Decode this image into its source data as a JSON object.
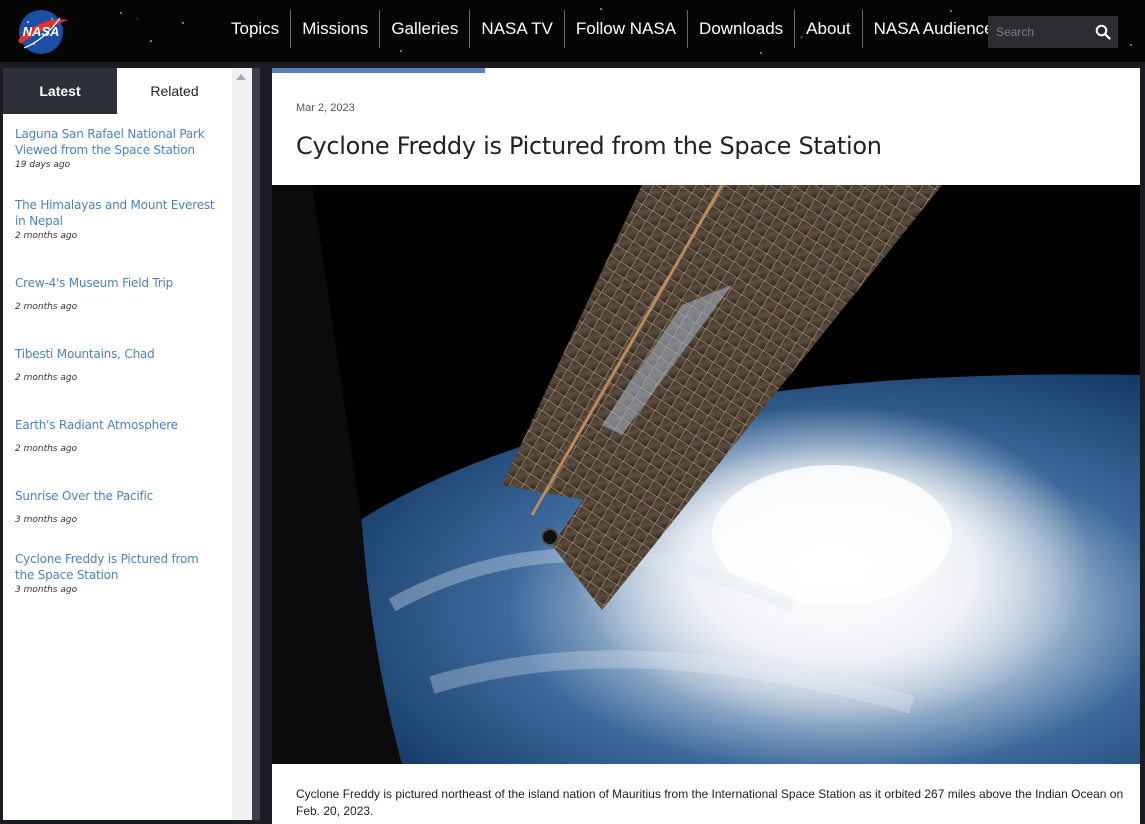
{
  "brand": {
    "logo_text": "NASA"
  },
  "nav": {
    "items": [
      "Topics",
      "Missions",
      "Galleries",
      "NASA TV",
      "Follow NASA",
      "Downloads",
      "About",
      "NASA Audiences"
    ]
  },
  "search": {
    "placeholder": "Search"
  },
  "sidebar": {
    "tabs": {
      "latest": "Latest",
      "related": "Related"
    },
    "items": [
      {
        "title": "Laguna San Rafael National Park Viewed from the Space Station",
        "age": "19 days ago"
      },
      {
        "title": "The Himalayas and Mount Everest in Nepal",
        "age": "2 months ago"
      },
      {
        "title": "Crew-4's Museum Field Trip",
        "age": "2 months ago"
      },
      {
        "title": "Tibesti Mountains, Chad",
        "age": "2 months ago"
      },
      {
        "title": "Earth's Radiant Atmosphere",
        "age": "2 months ago"
      },
      {
        "title": "Sunrise Over the Pacific",
        "age": "3 months ago"
      },
      {
        "title": "Cyclone Freddy is Pictured from the Space Station",
        "age": "3 months ago"
      }
    ]
  },
  "article": {
    "date": "Mar 2, 2023",
    "title": "Cyclone Freddy is Pictured from the Space Station",
    "caption": "Cyclone Freddy is pictured northeast of the island nation of Mauritius from the International Space Station as it orbited 267 miles above the Indian Ocean on Feb. 20, 2023."
  },
  "colors": {
    "accent": "#5b7fb8",
    "link": "#4f82b9",
    "nav_bg": "#050505",
    "tab_active_bg": "#2e3038"
  }
}
